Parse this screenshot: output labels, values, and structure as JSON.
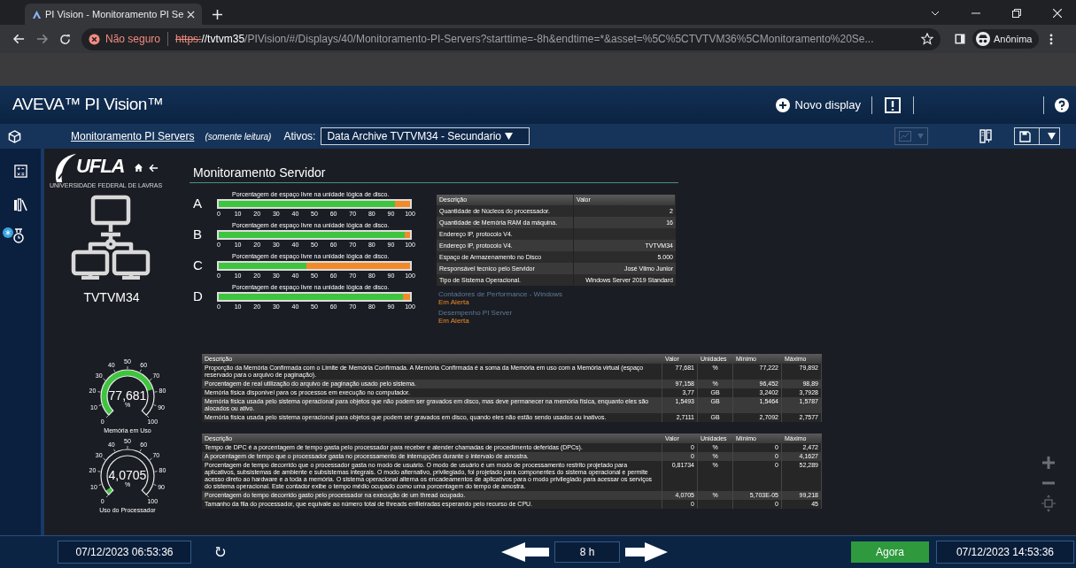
{
  "browser": {
    "tab_title": "PI Vision - Monitoramento PI Se",
    "security": "Não seguro",
    "url_scheme": "https:",
    "url_host": "//tvtvm35",
    "url_path": "/PIVision/#/Displays/40/Monitoramento-PI-Servers?starttime=-8h&endtime=*&asset=%5C%5CTVTVM36%5CMonitoramento%20Se...",
    "profile": "Anônima"
  },
  "app": {
    "title": "AVEVA™ PI Vision™",
    "new_display": "Novo display"
  },
  "toolbar": {
    "display_link": "Monitoramento PI Servers",
    "read_only": "(somente leitura)",
    "assets_label": "Ativos:",
    "asset_value": "Data Archive TVTVM34 - Secundario",
    "trend_button": {
      "disabled": true
    }
  },
  "display": {
    "logo": "UFLA",
    "logo_caption": "UNIVERSIDADE FEDERAL DE LAVRAS",
    "title": "Monitoramento Servidor",
    "server_name": "TVTVM34",
    "disks": [
      {
        "letter": "A",
        "caption": "Porcentagem de espaço livre na unidade lógica de disco.",
        "level": 0.92,
        "ticks": [
          "0",
          "10",
          "20",
          "30",
          "40",
          "50",
          "60",
          "70",
          "80",
          "90",
          "100"
        ]
      },
      {
        "letter": "B",
        "caption": "Porcentagem de espaço livre na unidade lógica de disco.",
        "level": 0.97,
        "ticks": [
          "0",
          "10",
          "20",
          "30",
          "40",
          "50",
          "60",
          "70",
          "80",
          "90",
          "100"
        ]
      },
      {
        "letter": "C",
        "caption": "Porcentagem de espaço livre na unidade lógica de disco.",
        "level": 0.46,
        "ticks": [
          "0",
          "10",
          "20",
          "30",
          "40",
          "50",
          "60",
          "70",
          "80",
          "90",
          "100"
        ]
      },
      {
        "letter": "D",
        "caption": "Porcentagem de espaço livre na unidade lógica de disco.",
        "level": 0.965,
        "ticks": [
          "0",
          "10",
          "20",
          "30",
          "40",
          "50",
          "60",
          "70",
          "80",
          "90",
          "100"
        ]
      }
    ],
    "info_table": {
      "columns": [
        "Descrição",
        "Valor"
      ],
      "rows": [
        {
          "description": "Quantidade de Núcleos do processador.",
          "value": "2"
        },
        {
          "description": "Quantidade de Memória RAM da máquina.",
          "value": "16"
        },
        {
          "description": "Endereço IP, protocolo V4."
        },
        {
          "description": "Endereço IP, protocolo V4.",
          "value": "TVTVM34"
        },
        {
          "description": "Espaço de Armazenamento no Disco",
          "value": "5.000"
        },
        {
          "description": "Responsável tecnico pelo Servidor",
          "value": "José Vilmo Junior"
        },
        {
          "description": "Tipo de Sistema Operacional.",
          "value": "Windows Server 2019 Standard"
        }
      ]
    },
    "status": [
      {
        "label": "Contadores de Performance - Windows",
        "state": "Em Alerta"
      },
      {
        "label": "Desempenho PI Server",
        "state": "Em Alerta"
      }
    ],
    "gauges": [
      {
        "value": "77,681",
        "unit": "%",
        "label": "Memória em Uso",
        "ticks": [
          "0",
          "10",
          "20",
          "30",
          "40",
          "50",
          "60",
          "70",
          "80",
          "90",
          "100"
        ]
      },
      {
        "value": "4,0705",
        "unit": "%",
        "label": "Uso do Processador",
        "ticks": [
          "0",
          "10",
          "20",
          "30",
          "40",
          "50",
          "60",
          "70",
          "80",
          "90",
          "100"
        ]
      }
    ],
    "memory_table": {
      "columns": [
        "Descrição",
        "Valor",
        "Unidades",
        "Mínimo",
        "Máximo"
      ],
      "rows": [
        [
          "Proporção da Memória Confirmada com o Limite de Memória Confirmada. A Memória Confirmada é a soma da Memória em uso com a Memória virtual (espaço reservado para o arquivo de paginação).",
          "77,681",
          "%",
          "77,222",
          "79,892"
        ],
        [
          "Porcentagem de real utilização do arquivo de paginação usado pelo sistema.",
          "97,158",
          "%",
          "96,452",
          "98,89"
        ],
        [
          "Memória física disponível para os processos em execução no computador.",
          "3,77",
          "GB",
          "3,2402",
          "3,7928"
        ],
        [
          "Memória física usada pelo sistema operacional para objetos que não podem ser gravados em disco, mas deve permanecer na memória física, enquanto eles são alocados ou ativo.",
          "1,5493",
          "GB",
          "1,5464",
          "1,5787"
        ],
        [
          "Memória física usada pelo sistema operacional para objetos que podem ser gravados em disco, quando eles não estão sendo usados ou inativos.",
          "2,7111",
          "GB",
          "2,7092",
          "2,7577"
        ]
      ]
    },
    "processor_table": {
      "columns": [
        "Descrição",
        "Valor",
        "Unidades",
        "Mínimo",
        "Máximo"
      ],
      "rows": [
        [
          "Tempo de DPC é a porcentagem de tempo gasta pelo processador para receber e atender chamadas de procedimento deferidas (DPCs).",
          "0",
          "%",
          "0",
          "2,472"
        ],
        [
          "A porcentagem de tempo que o processador gasta no processamento de interrupções durante o intervalo de amostra.",
          "0",
          "%",
          "0",
          "4,1627"
        ],
        [
          "Porcentagem de tempo decorrido que o processador gasta no modo de usuário. O modo de usuário é um modo de processamento restrito projetado para aplicativos, subsistemas de ambiente e subsistemas integrais. O modo alternativo, privilegiado, foi projetado para componentes do sistema operacional e permite acesso direto ao hardware e a toda a memória. O sistema operacional alterna os encadeamentos de aplicativos para o modo privilegiado para acessar os serviços do sistema operacional. Este contador exibe o tempo médio ocupado como uma porcentagem do tempo de amostra.",
          "0,81734",
          "%",
          "0",
          "52,289"
        ],
        [
          "Porcentagem do tempo decorrido gasto pelo processador na execução de um thread ocupado.",
          "4,0705",
          "%",
          "5,703E-05",
          "99,218"
        ],
        [
          "Tamanho da fila do processador, que equivale ao número total de threads enfileiradas esperando pelo recurso de CPU.",
          "0",
          null,
          "0",
          "45"
        ]
      ]
    }
  },
  "time_bar": {
    "start": "07/12/2023 06:53:36",
    "duration": "8 h",
    "now": "Agora",
    "end": "07/12/2023 14:53:36"
  }
}
